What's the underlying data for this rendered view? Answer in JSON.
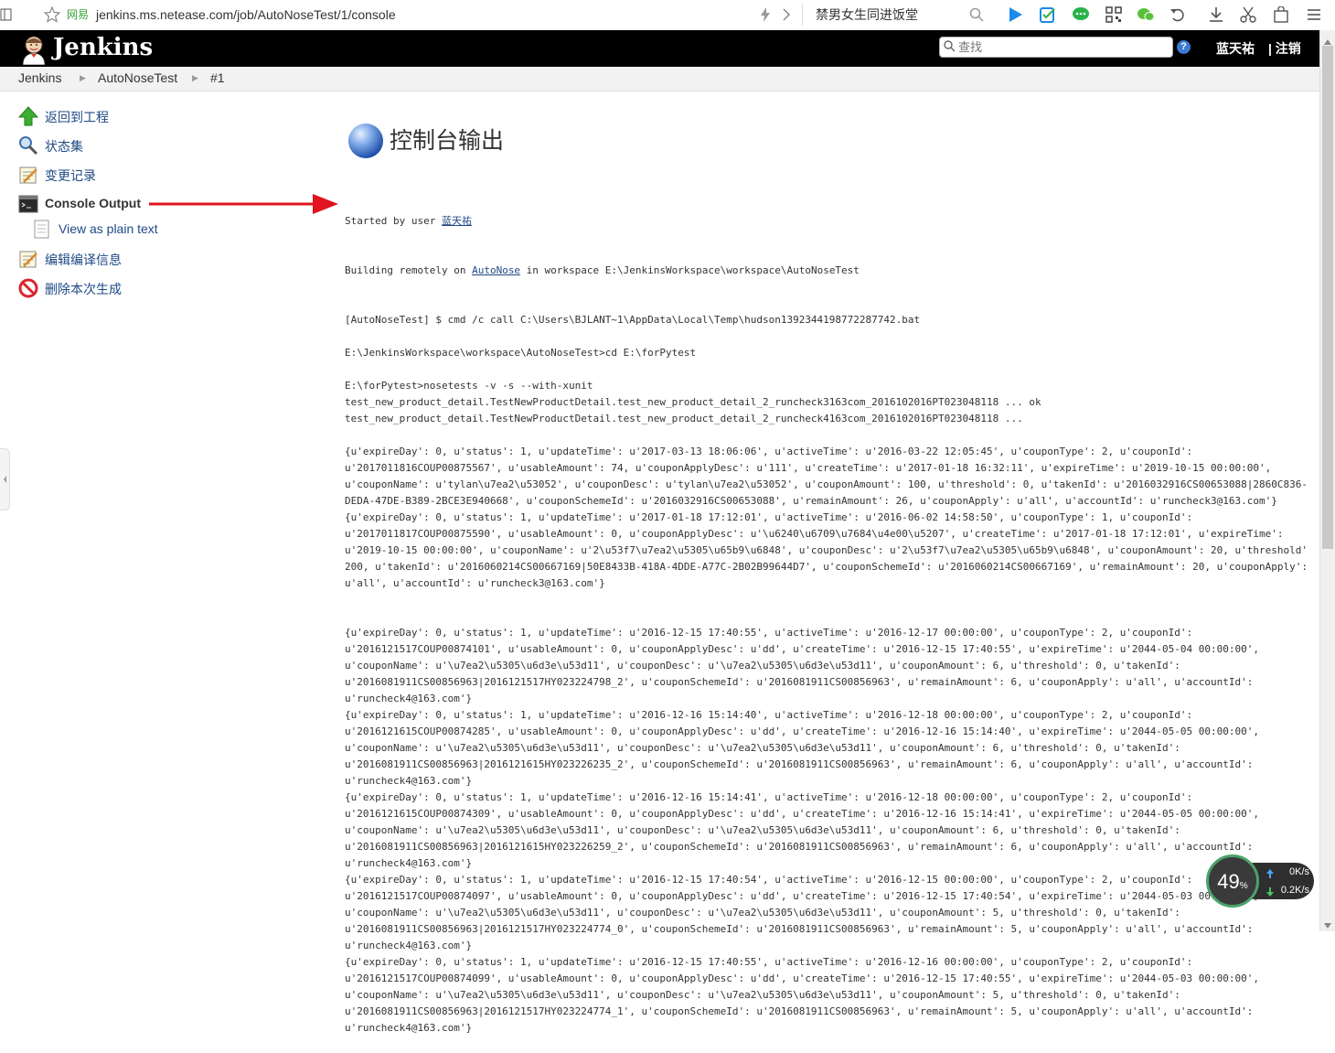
{
  "browser": {
    "site_label": "网易",
    "url": "jenkins.ms.netease.com/job/AutoNoseTest/1/console",
    "search_text": "禁男女生同进饭堂"
  },
  "header": {
    "brand": "Jenkins",
    "search_placeholder": "查找",
    "help": "?",
    "user": "蓝天祐",
    "logout": "| 注销"
  },
  "breadcrumbs": [
    "Jenkins",
    "AutoNoseTest",
    "#1"
  ],
  "tasks": [
    {
      "label": "返回到工程",
      "icon": "up-arrow-icon"
    },
    {
      "label": "状态集",
      "icon": "magnifier-icon"
    },
    {
      "label": "变更记录",
      "icon": "notepad-icon"
    },
    {
      "label": "Console Output",
      "icon": "terminal-icon",
      "current": true
    },
    {
      "label": "View as plain text",
      "icon": "document-icon"
    },
    {
      "label": "编辑编译信息",
      "icon": "notepad-icon"
    },
    {
      "label": "删除本次生成",
      "icon": "no-entry-icon"
    }
  ],
  "main": {
    "title": "控制台输出",
    "started_by_prefix": "Started by user ",
    "started_by_user": "蓝天祐",
    "building_prefix": "Building remotely on ",
    "building_node": "AutoNose",
    "building_suffix": " in workspace E:\\JenkinsWorkspace\\workspace\\AutoNoseTest",
    "console_lines": [
      "[AutoNoseTest] $ cmd /c call C:\\Users\\BJLANT~1\\AppData\\Local\\Temp\\hudson1392344198772287742.bat",
      "",
      "E:\\JenkinsWorkspace\\workspace\\AutoNoseTest>cd E:\\forPytest",
      "",
      "E:\\forPytest>nosetests -v -s --with-xunit",
      "test_new_product_detail.TestNewProductDetail.test_new_product_detail_2_runcheck3163com_2016102016PT023048118 ... ok",
      "test_new_product_detail.TestNewProductDetail.test_new_product_detail_2_runcheck4163com_2016102016PT023048118 ...",
      "",
      "{u'expireDay': 0, u'status': 1, u'updateTime': u'2017-03-13 18:06:06', u'activeTime': u'2016-03-22 12:05:45', u'couponType': 2, u'couponId':",
      "u'2017011816COUP00875567', u'usableAmount': 74, u'couponApplyDesc': u'111', u'createTime': u'2017-01-18 16:32:11', u'expireTime': u'2019-10-15 00:00:00',",
      "u'couponName': u'tylan\\u7ea2\\u53052', u'couponDesc': u'tylan\\u7ea2\\u53052', u'couponAmount': 100, u'threshold': 0, u'takenId': u'2016032916CS00653088|2860C836-",
      "DEDA-47DE-B389-2BCE3E940668', u'couponSchemeId': u'2016032916CS00653088', u'remainAmount': 26, u'couponApply': u'all', u'accountId': u'runcheck3@163.com'}",
      "{u'expireDay': 0, u'status': 1, u'updateTime': u'2017-01-18 17:12:01', u'activeTime': u'2016-06-02 14:58:50', u'couponType': 1, u'couponId':",
      "u'2017011817COUP00875590', u'usableAmount': 0, u'couponApplyDesc': u'\\u6240\\u6709\\u7684\\u4e00\\u5207', u'createTime': u'2017-01-18 17:12:01', u'expireTime':",
      "u'2019-10-15 00:00:00', u'couponName': u'2\\u53f7\\u7ea2\\u5305\\u65b9\\u6848', u'couponDesc': u'2\\u53f7\\u7ea2\\u5305\\u65b9\\u6848', u'couponAmount': 20, u'threshold':",
      "200, u'takenId': u'2016060214CS00667169|50E8433B-418A-4DDE-A77C-2B02B99644D7', u'couponSchemeId': u'2016060214CS00667169', u'remainAmount': 20, u'couponApply':",
      "u'all', u'accountId': u'runcheck3@163.com'}",
      "",
      "",
      "{u'expireDay': 0, u'status': 1, u'updateTime': u'2016-12-15 17:40:55', u'activeTime': u'2016-12-17 00:00:00', u'couponType': 2, u'couponId':",
      "u'2016121517COUP00874101', u'usableAmount': 0, u'couponApplyDesc': u'dd', u'createTime': u'2016-12-15 17:40:55', u'expireTime': u'2044-05-04 00:00:00',",
      "u'couponName': u'\\u7ea2\\u5305\\u6d3e\\u53d11', u'couponDesc': u'\\u7ea2\\u5305\\u6d3e\\u53d11', u'couponAmount': 6, u'threshold': 0, u'takenId':",
      "u'2016081911CS00856963|2016121517HY023224798_2', u'couponSchemeId': u'2016081911CS00856963', u'remainAmount': 6, u'couponApply': u'all', u'accountId':",
      "u'runcheck4@163.com'}",
      "{u'expireDay': 0, u'status': 1, u'updateTime': u'2016-12-16 15:14:40', u'activeTime': u'2016-12-18 00:00:00', u'couponType': 2, u'couponId':",
      "u'2016121615COUP00874285', u'usableAmount': 0, u'couponApplyDesc': u'dd', u'createTime': u'2016-12-16 15:14:40', u'expireTime': u'2044-05-05 00:00:00',",
      "u'couponName': u'\\u7ea2\\u5305\\u6d3e\\u53d11', u'couponDesc': u'\\u7ea2\\u5305\\u6d3e\\u53d11', u'couponAmount': 6, u'threshold': 0, u'takenId':",
      "u'2016081911CS00856963|2016121615HY023226235_2', u'couponSchemeId': u'2016081911CS00856963', u'remainAmount': 6, u'couponApply': u'all', u'accountId':",
      "u'runcheck4@163.com'}",
      "{u'expireDay': 0, u'status': 1, u'updateTime': u'2016-12-16 15:14:41', u'activeTime': u'2016-12-18 00:00:00', u'couponType': 2, u'couponId':",
      "u'2016121615COUP00874309', u'usableAmount': 0, u'couponApplyDesc': u'dd', u'createTime': u'2016-12-16 15:14:41', u'expireTime': u'2044-05-05 00:00:00',",
      "u'couponName': u'\\u7ea2\\u5305\\u6d3e\\u53d11', u'couponDesc': u'\\u7ea2\\u5305\\u6d3e\\u53d11', u'couponAmount': 6, u'threshold': 0, u'takenId':",
      "u'2016081911CS00856963|2016121615HY023226259_2', u'couponSchemeId': u'2016081911CS00856963', u'remainAmount': 6, u'couponApply': u'all', u'accountId':",
      "u'runcheck4@163.com'}",
      "{u'expireDay': 0, u'status': 1, u'updateTime': u'2016-12-15 17:40:54', u'activeTime': u'2016-12-15 00:00:00', u'couponType': 2, u'couponId':",
      "u'2016121517COUP00874097', u'usableAmount': 0, u'couponApplyDesc': u'dd', u'createTime': u'2016-12-15 17:40:54', u'expireTime': u'2044-05-03 00:00:00',",
      "u'couponName': u'\\u7ea2\\u5305\\u6d3e\\u53d11', u'couponDesc': u'\\u7ea2\\u5305\\u6d3e\\u53d11', u'couponAmount': 5, u'threshold': 0, u'takenId':",
      "u'2016081911CS00856963|2016121517HY023224774_0', u'couponSchemeId': u'2016081911CS00856963', u'remainAmount': 5, u'couponApply': u'all', u'accountId':",
      "u'runcheck4@163.com'}",
      "{u'expireDay': 0, u'status': 1, u'updateTime': u'2016-12-15 17:40:55', u'activeTime': u'2016-12-16 00:00:00', u'couponType': 2, u'couponId':",
      "u'2016121517COUP00874099', u'usableAmount': 0, u'couponApplyDesc': u'dd', u'createTime': u'2016-12-15 17:40:55', u'expireTime': u'2044-05-03 00:00:00',",
      "u'couponName': u'\\u7ea2\\u5305\\u6d3e\\u53d11', u'couponDesc': u'\\u7ea2\\u5305\\u6d3e\\u53d11', u'couponAmount': 5, u'threshold': 0, u'takenId':",
      "u'2016081911CS00856963|2016121517HY023224774_1', u'couponSchemeId': u'2016081911CS00856963', u'remainAmount': 5, u'couponApply': u'all', u'accountId':",
      "u'runcheck4@163.com'}"
    ]
  },
  "speed_widget": {
    "percent": "49",
    "percent_unit": "%",
    "upload": "0K/s",
    "download": "0.2K/s"
  },
  "colors": {
    "header_bg": "#000000",
    "link": "#204a87",
    "arrow": "#e0131f"
  }
}
